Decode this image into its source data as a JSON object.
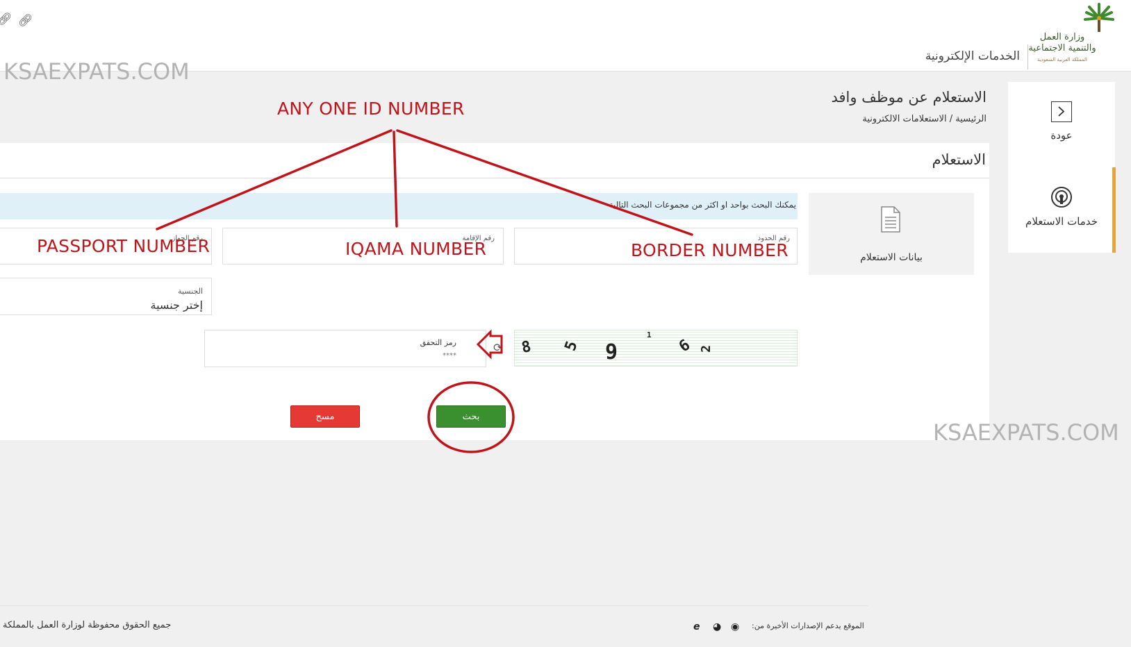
{
  "header": {
    "portal_title": "الخدمات الإلكترونية",
    "logo": {
      "line1": "وزارة العمل",
      "line2": "والتنمية الاجتماعية",
      "line3": "المملكة العربية السعودية"
    },
    "icons": [
      "link-icon",
      "link-icon"
    ]
  },
  "sidebar": {
    "back_label": "عودة",
    "services_label": "خدمات الاستعلام",
    "accent_color": "#e8a33d"
  },
  "page": {
    "title": "الاستعلام عن موظف وافد",
    "breadcrumb": "الرئيسية / الاستعلامات الالكترونية"
  },
  "panel": {
    "heading": "الاستعلام",
    "data_card_label": "بيانات الاستعلام",
    "info_text": "يمكنك البحث بواحد او اكثر من مجموعات البحث التالية",
    "fields": {
      "border_label": "رقم الحدود",
      "iqama_label": "رقم الإقامة",
      "passport_label": "رقم الجواز",
      "nationality_label": "الجنسية",
      "nationality_value": "إختر جنسية",
      "captcha_label": "رمز التحقق",
      "captcha_placeholder": "****"
    },
    "captcha_chars": [
      "8",
      "5",
      "9",
      "1",
      "6",
      "2"
    ],
    "buttons": {
      "search": "بحث",
      "clear": "مسح"
    },
    "button_colors": {
      "search": "#3a8f2e",
      "clear": "#e53935"
    }
  },
  "annotations": {
    "any_one": "ANY ONE ID NUMBER",
    "passport": "PASSPORT NUMBER",
    "iqama": "IQAMA NUMBER",
    "border": "BORDER NUMBER",
    "color": "#c0141b"
  },
  "watermark": "KSAEXPATS.COM",
  "footer": {
    "rights": "جميع الحقوق محفوظة لوزارة العمل بالمملكة",
    "support": "الموقع يدعم الإصدارات الأخيرة من:",
    "browser_icons": [
      "ie-icon",
      "firefox-icon",
      "chrome-icon"
    ]
  }
}
